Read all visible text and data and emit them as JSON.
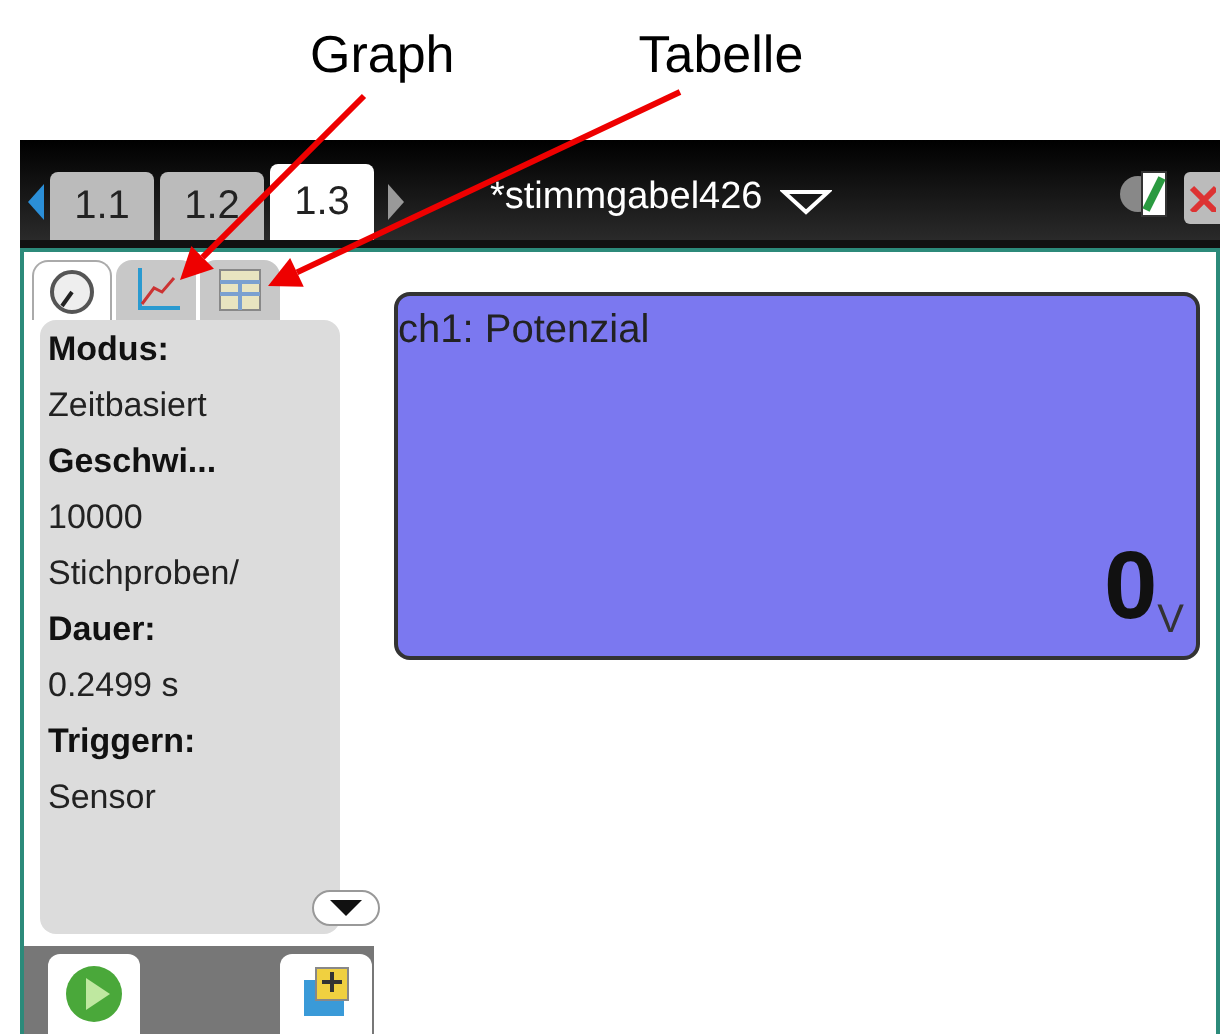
{
  "annotations": [
    {
      "label": "Graph"
    },
    {
      "label": "Tabelle"
    }
  ],
  "document_tabs": [
    {
      "label": "1.1",
      "selected": false
    },
    {
      "label": "1.2",
      "selected": false
    },
    {
      "label": "1.3",
      "selected": true
    }
  ],
  "document_title": "*stimmgabel426",
  "app_tabs": [
    {
      "kind": "meter",
      "selected": true
    },
    {
      "kind": "graph",
      "selected": false
    },
    {
      "kind": "table",
      "selected": false
    }
  ],
  "sidebar": [
    {
      "kind": "heading",
      "text": "Modus:"
    },
    {
      "kind": "value",
      "text": "Zeitbasiert"
    },
    {
      "kind": "heading",
      "text": "Geschwi..."
    },
    {
      "kind": "value",
      "text": "10000"
    },
    {
      "kind": "value",
      "text": "Stichproben/"
    },
    {
      "kind": "heading",
      "text": "Dauer:"
    },
    {
      "kind": "value",
      "text": "0.2499 s"
    },
    {
      "kind": "heading",
      "text": "Triggern:"
    },
    {
      "kind": "value",
      "text": "Sensor"
    }
  ],
  "meter": {
    "label": "ch1: Potenzial",
    "value": "0",
    "unit": "V"
  }
}
